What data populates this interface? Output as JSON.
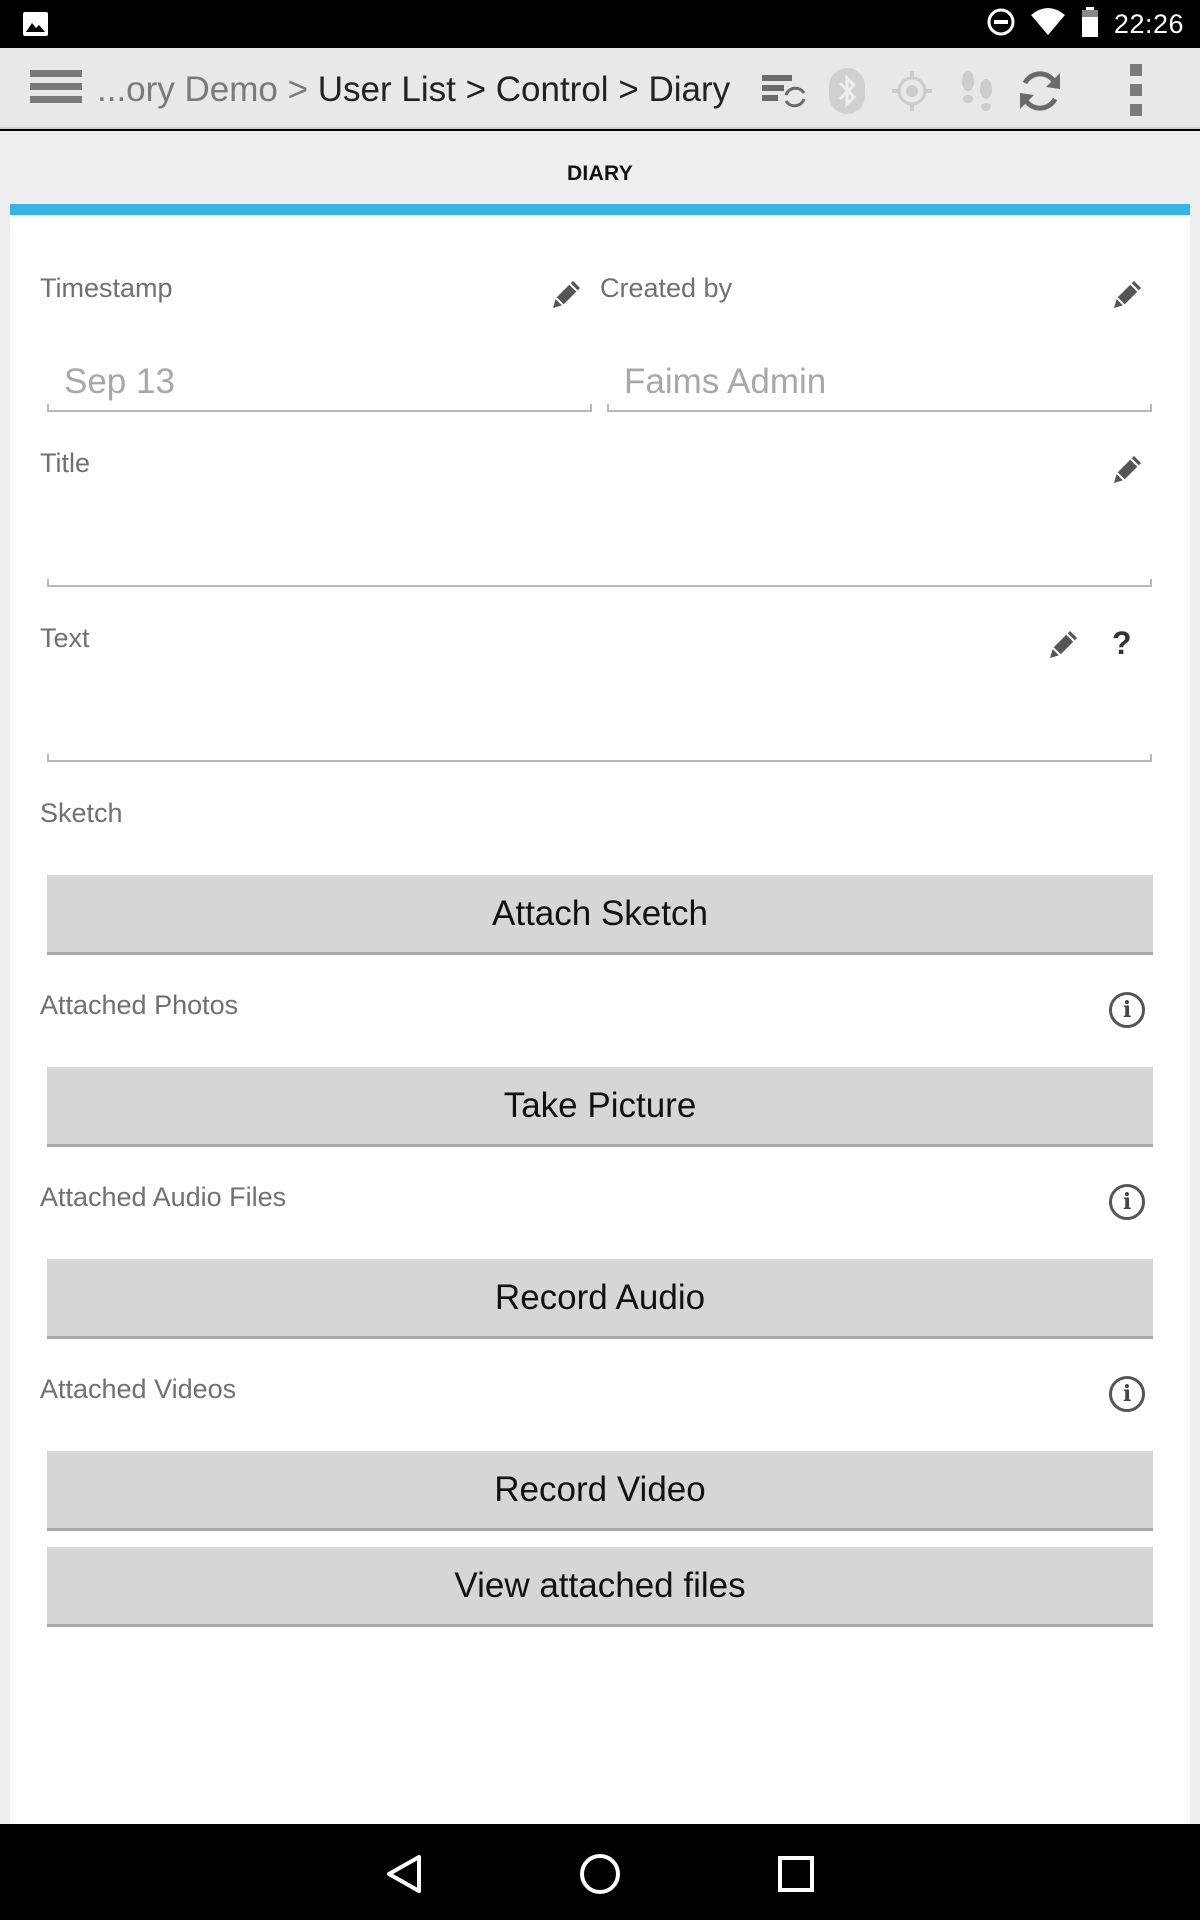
{
  "status_bar": {
    "time": "22:26",
    "icons": [
      "image-icon",
      "do-not-disturb-icon",
      "wifi-icon",
      "battery-icon"
    ]
  },
  "action_bar": {
    "breadcrumb_faded": "...ory Demo > ",
    "breadcrumb_current": "User List > Control > Diary",
    "icons": [
      "menu-icon",
      "sync-status-icon",
      "bluetooth-icon",
      "gps-icon",
      "tracking-icon",
      "refresh-icon",
      "overflow-menu-icon"
    ]
  },
  "tabs": [
    {
      "label": "DIARY",
      "selected": true
    }
  ],
  "form": {
    "timestamp": {
      "label": "Timestamp",
      "value": "Sep 13"
    },
    "created_by": {
      "label": "Created by",
      "value": "Faims Admin"
    },
    "title": {
      "label": "Title",
      "value": ""
    },
    "text": {
      "label": "Text",
      "value": "",
      "help": "?"
    },
    "sketch": {
      "label": "Sketch",
      "button": "Attach Sketch"
    },
    "photos": {
      "label": "Attached Photos",
      "button": "Take Picture",
      "info": "i"
    },
    "audio": {
      "label": "Attached Audio Files",
      "button": "Record Audio",
      "info": "i"
    },
    "videos": {
      "label": "Attached Videos",
      "button": "Record Video",
      "info": "i"
    },
    "view_files_button": "View attached files"
  },
  "colors": {
    "accent": "#33b5e5",
    "action_bar": "#e8e8e8",
    "button": "#d6d6d6"
  }
}
